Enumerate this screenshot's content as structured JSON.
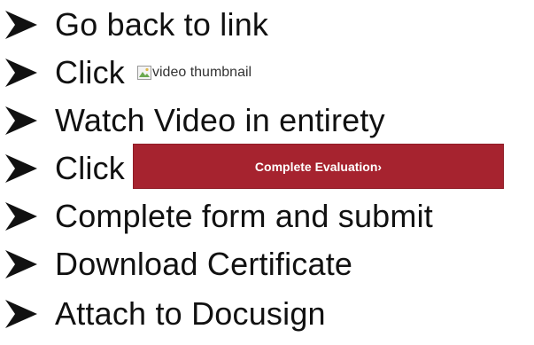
{
  "steps": [
    {
      "text": "Go back to link"
    },
    {
      "text": "Click",
      "thumbnail_alt": "video thumbnail"
    },
    {
      "text": "Watch Video in entirety"
    },
    {
      "text": "Click",
      "button_label": "Complete Evaluation›"
    },
    {
      "text": "Complete form and submit"
    },
    {
      "text": "Download Certificate"
    },
    {
      "text": "Attach to Docusign"
    }
  ],
  "colors": {
    "button_bg": "#a6232f",
    "button_text": "#ffffff",
    "text": "#111111"
  },
  "icons": {
    "bullet": "arrow-bullet-icon",
    "thumbnail": "broken-image-icon"
  }
}
